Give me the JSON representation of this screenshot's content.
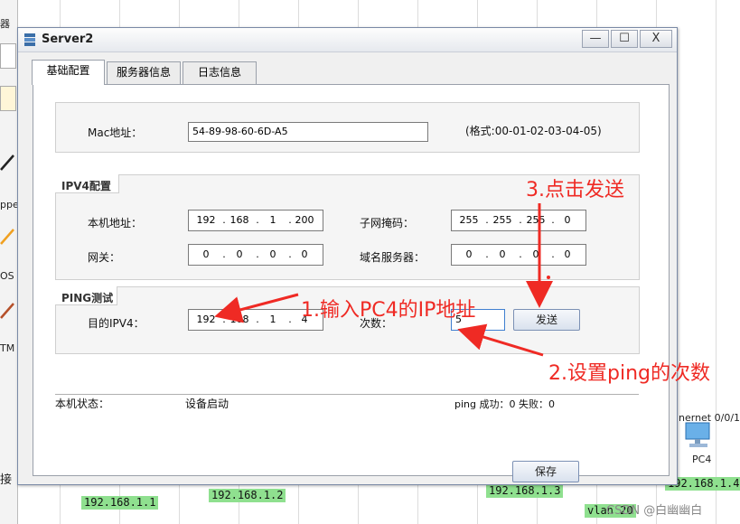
{
  "window": {
    "title": "Server2",
    "controls": {
      "minimize": "—",
      "maximize": "☐",
      "close": "X"
    }
  },
  "tabs": [
    "基础配置",
    "服务器信息",
    "日志信息"
  ],
  "mac": {
    "label": "Mac地址：",
    "value": "54-89-98-60-6D-A5",
    "format": "(格式:00-01-02-03-04-05)"
  },
  "ipv4": {
    "section": "IPV4配置",
    "local_label": "本机地址：",
    "local": [
      "192",
      "168",
      "1",
      "200"
    ],
    "mask_label": "子网掩码：",
    "mask": [
      "255",
      "255",
      "255",
      "0"
    ],
    "gateway_label": "网关：",
    "gateway": [
      "0",
      "0",
      "0",
      "0"
    ],
    "dns_label": "域名服务器：",
    "dns": [
      "0",
      "0",
      "0",
      "0"
    ]
  },
  "ping": {
    "section": "PING测试",
    "dest_label": "目的IPV4：",
    "dest": [
      "192",
      "168",
      "1",
      "4"
    ],
    "count_label": "次数：",
    "count": "5",
    "send_label": "发送"
  },
  "status": {
    "label": "本机状态：",
    "value": "设备启动",
    "result": "ping 成功：0 失败：0"
  },
  "save_label": "保存",
  "annotations": {
    "a1": "1.输入PC4的IP地址",
    "a2": "2.设置ping的次数",
    "a3": "3.点击发送"
  },
  "background": {
    "left_strip": [
      "器",
      "ppe",
      "OS",
      "TM",
      "接"
    ],
    "ips": [
      "192.168.1.1",
      "192.168.1.2",
      "192.168.1.3",
      "192.168.1.4"
    ],
    "pc4_label": "PC4",
    "port_label": "nernet 0/0/1",
    "vlan_label": "vlan 20",
    "watermark": "CSDN @白幽幽白"
  },
  "colors": {
    "annotation": "#ef2a24",
    "ip_badge": "#8fe08f",
    "window_border": "#7a8aa6"
  }
}
